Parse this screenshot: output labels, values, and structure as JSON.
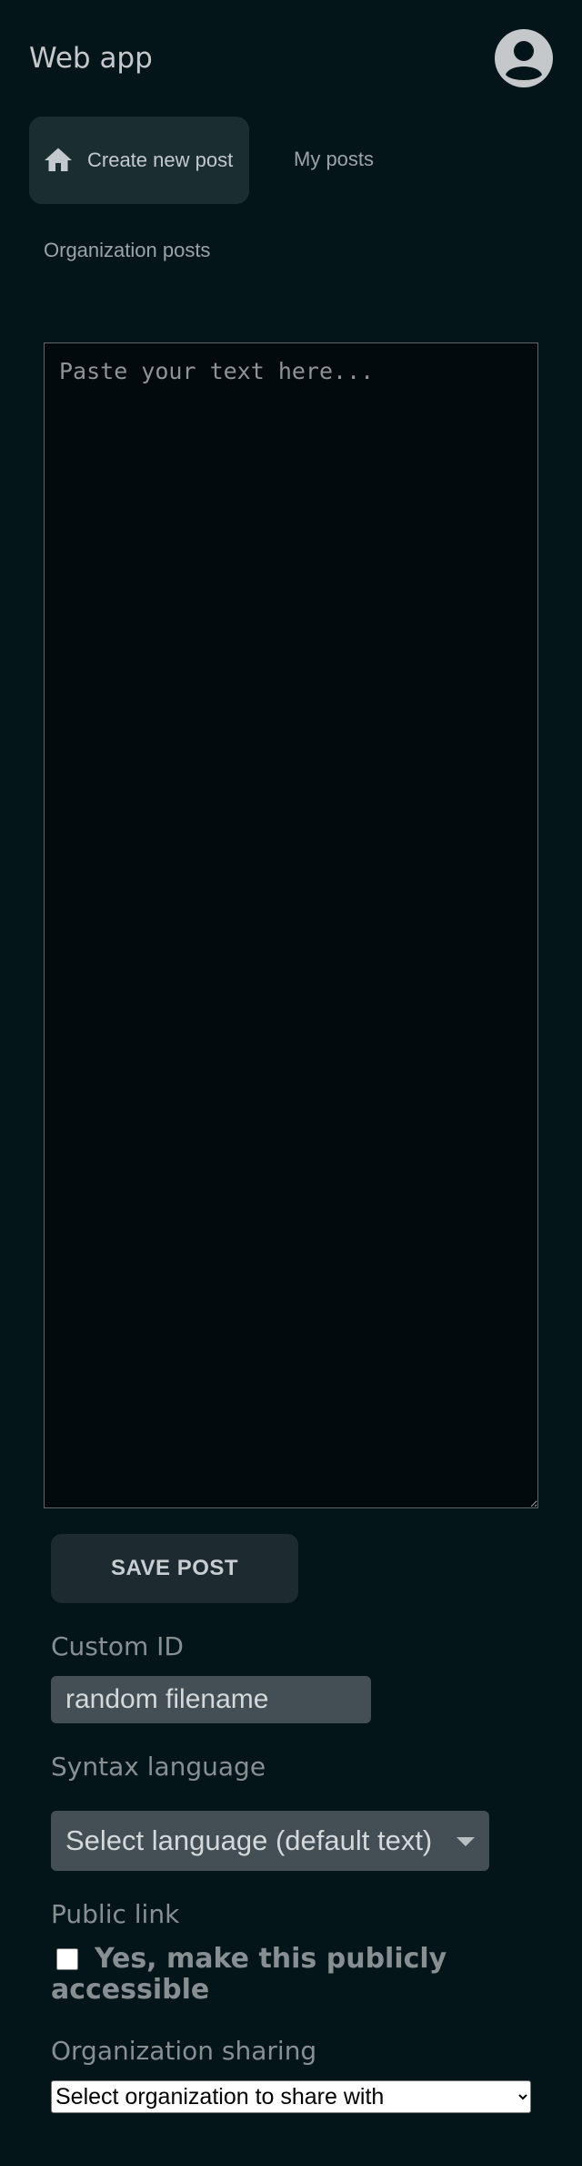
{
  "header": {
    "app_title": "Web app",
    "avatar_icon": "account-circle-icon"
  },
  "nav": {
    "tabs": [
      {
        "label": "Create new post",
        "icon": "home-icon",
        "active": true
      },
      {
        "label": "My posts",
        "active": false
      },
      {
        "label": "Organization posts",
        "active": false
      }
    ]
  },
  "editor": {
    "placeholder": "Paste your text here...",
    "value": ""
  },
  "form": {
    "save_label": "SAVE POST",
    "custom_id_label": "Custom ID",
    "custom_id_placeholder": "random filename",
    "syntax_label": "Syntax language",
    "syntax_selected": "Select language (default text)",
    "public_label": "Public link",
    "public_checkbox_text": "Yes, make this publicly accessible",
    "public_checked": false,
    "org_label": "Organization sharing",
    "org_selected": "Select organization to share with"
  },
  "colors": {
    "background": "#04151a",
    "active_tab": "#1a2e30",
    "input_bg": "#434f54",
    "button_bg": "#1d2b31",
    "label_text": "#878f93"
  }
}
